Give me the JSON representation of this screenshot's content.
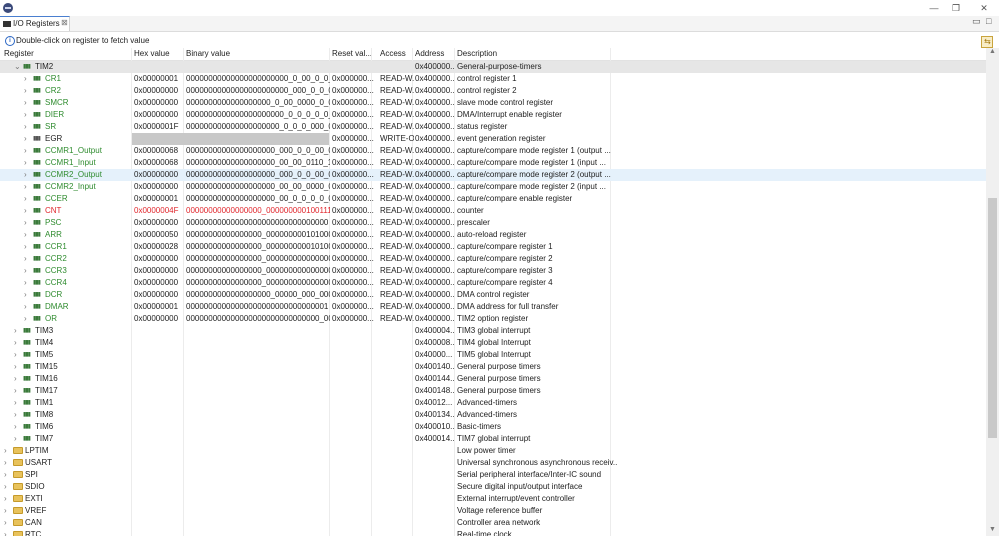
{
  "window": {
    "tab_label": "I/O Registers",
    "tab_close": "⊠",
    "minimize": "—",
    "restore": "❐",
    "close": "✕",
    "view_min": "▭",
    "view_max": "□"
  },
  "info": {
    "text": "Double-click on register to fetch value"
  },
  "refresh_icon": "⇆",
  "columns": [
    "Register",
    "Hex value",
    "Binary value",
    "Reset val...",
    "Access",
    "Address",
    "Description"
  ],
  "rows": [
    {
      "name": "TIM2",
      "hex": "",
      "bin": "",
      "reset": "",
      "access": "",
      "addr": "0x400000...",
      "desc": "General-purpose-timers",
      "level": 1,
      "exp": "v",
      "icon": "reg",
      "color": "",
      "style": "sel"
    },
    {
      "name": "CR1",
      "hex": "0x00000001",
      "bin": "00000000000000000000000_0_00_0_0_...",
      "reset": "0x000000...",
      "access": "READ-W...",
      "addr": "0x400000...",
      "desc": "control register 1",
      "level": 2,
      "exp": ">",
      "icon": "reg",
      "color": "green",
      "style": ""
    },
    {
      "name": "CR2",
      "hex": "0x00000000",
      "bin": "00000000000000000000000_000_0_0_0...",
      "reset": "0x000000...",
      "access": "READ-W...",
      "addr": "0x400000...",
      "desc": "control register 2",
      "level": 2,
      "exp": ">",
      "icon": "reg",
      "color": "green",
      "style": ""
    },
    {
      "name": "SMCR",
      "hex": "0x00000000",
      "bin": "0000000000000000000_0_00_0000_0_000_...",
      "reset": "0x000000...",
      "access": "READ-W...",
      "addr": "0x400000...",
      "desc": "slave mode control register",
      "level": 2,
      "exp": ">",
      "icon": "reg",
      "color": "green",
      "style": ""
    },
    {
      "name": "DIER",
      "hex": "0x00000000",
      "bin": "0000000000000000000000_0_0_0_0_0_0_...",
      "reset": "0x000000...",
      "access": "READ-W...",
      "addr": "0x400000...",
      "desc": "DMA/Interrupt enable register",
      "level": 2,
      "exp": ">",
      "icon": "reg",
      "color": "green",
      "style": ""
    },
    {
      "name": "SR",
      "hex": "0x0000001F",
      "bin": "000000000000000000000_0_0_0_000_01_...",
      "reset": "0x000000...",
      "access": "READ-W...",
      "addr": "0x400000...",
      "desc": "status register",
      "level": 2,
      "exp": ">",
      "icon": "reg",
      "color": "green",
      "style": ""
    },
    {
      "name": "EGR",
      "hex": "",
      "bin": "",
      "reset": "0x000000...",
      "access": "WRITE-O...",
      "addr": "0x400000...",
      "desc": "event generation register",
      "level": 2,
      "exp": ">",
      "icon": "gray",
      "color": "",
      "style": "",
      "gray": true
    },
    {
      "name": "CCMR1_Output",
      "hex": "0x00000068",
      "bin": "00000000000000000000_000_0_0_00_0_110...",
      "reset": "0x000000...",
      "access": "READ-W...",
      "addr": "0x400000...",
      "desc": "capture/compare mode register 1 (output ...",
      "level": 2,
      "exp": ">",
      "icon": "reg",
      "color": "green",
      "style": ""
    },
    {
      "name": "CCMR1_Input",
      "hex": "0x00000068",
      "bin": "00000000000000000000_00_00_0110_1...",
      "reset": "0x000000...",
      "access": "READ-W...",
      "addr": "0x400000...",
      "desc": "capture/compare mode register 1 (input ...",
      "level": 2,
      "exp": ">",
      "icon": "reg",
      "color": "green",
      "style": ""
    },
    {
      "name": "CCMR2_Output",
      "hex": "0x00000000",
      "bin": "00000000000000000000_000_0_0_00_0_000...",
      "reset": "0x000000...",
      "access": "READ-W...",
      "addr": "0x400000...",
      "desc": "capture/compare mode register 2 (output ...",
      "level": 2,
      "exp": ">",
      "icon": "reg",
      "color": "green",
      "style": "hl"
    },
    {
      "name": "CCMR2_Input",
      "hex": "0x00000000",
      "bin": "00000000000000000000_00_00_0000_0...",
      "reset": "0x000000...",
      "access": "READ-W...",
      "addr": "0x400000...",
      "desc": "capture/compare mode register 2 (input ...",
      "level": 2,
      "exp": ">",
      "icon": "reg",
      "color": "green",
      "style": ""
    },
    {
      "name": "CCER",
      "hex": "0x00000001",
      "bin": "00000000000000000000_00_0_0_0_0_0_0_...",
      "reset": "0x000000...",
      "access": "READ-W...",
      "addr": "0x400000...",
      "desc": "capture/compare enable register",
      "level": 2,
      "exp": ">",
      "icon": "reg",
      "color": "green",
      "style": ""
    },
    {
      "name": "CNT",
      "hex": "0x0000004F",
      "bin": "00000000000000000_0000000001001111",
      "reset": "0x000000...",
      "access": "READ-W...",
      "addr": "0x400000...",
      "desc": "counter",
      "level": 2,
      "exp": ">",
      "icon": "reg",
      "color": "red",
      "style": ""
    },
    {
      "name": "PSC",
      "hex": "0x00000000",
      "bin": "00000000000000000000000000000000",
      "reset": "0x000000...",
      "access": "READ-W...",
      "addr": "0x400000...",
      "desc": "prescaler",
      "level": 2,
      "exp": ">",
      "icon": "reg",
      "color": "green",
      "style": ""
    },
    {
      "name": "ARR",
      "hex": "0x00000050",
      "bin": "00000000000000000_0000000001010000",
      "reset": "0x000000...",
      "access": "READ-W...",
      "addr": "0x400000...",
      "desc": "auto-reload register",
      "level": 2,
      "exp": ">",
      "icon": "reg",
      "color": "green",
      "style": ""
    },
    {
      "name": "CCR1",
      "hex": "0x00000028",
      "bin": "00000000000000000_0000000000101000",
      "reset": "0x000000...",
      "access": "READ-W...",
      "addr": "0x400000...",
      "desc": "capture/compare register 1",
      "level": 2,
      "exp": ">",
      "icon": "reg",
      "color": "green",
      "style": ""
    },
    {
      "name": "CCR2",
      "hex": "0x00000000",
      "bin": "00000000000000000_0000000000000000",
      "reset": "0x000000...",
      "access": "READ-W...",
      "addr": "0x400000...",
      "desc": "capture/compare register 2",
      "level": 2,
      "exp": ">",
      "icon": "reg",
      "color": "green",
      "style": ""
    },
    {
      "name": "CCR3",
      "hex": "0x00000000",
      "bin": "00000000000000000_0000000000000000",
      "reset": "0x000000...",
      "access": "READ-W...",
      "addr": "0x400000...",
      "desc": "capture/compare register 3",
      "level": 2,
      "exp": ">",
      "icon": "reg",
      "color": "green",
      "style": ""
    },
    {
      "name": "CCR4",
      "hex": "0x00000000",
      "bin": "00000000000000000_0000000000000000",
      "reset": "0x000000...",
      "access": "READ-W...",
      "addr": "0x400000...",
      "desc": "capture/compare register 4",
      "level": 2,
      "exp": ">",
      "icon": "reg",
      "color": "green",
      "style": ""
    },
    {
      "name": "DCR",
      "hex": "0x00000000",
      "bin": "0000000000000000000_00000_000_00000",
      "reset": "0x000000...",
      "access": "READ-W...",
      "addr": "0x400000...",
      "desc": "DMA control register",
      "level": 2,
      "exp": ">",
      "icon": "reg",
      "color": "green",
      "style": ""
    },
    {
      "name": "DMAR",
      "hex": "0x00000001",
      "bin": "00000000000000000000000000000001",
      "reset": "0x000000...",
      "access": "READ-W...",
      "addr": "0x400000...",
      "desc": "DMA address for full transfer",
      "level": 2,
      "exp": ">",
      "icon": "reg",
      "color": "green",
      "style": ""
    },
    {
      "name": "OR",
      "hex": "0x00000000",
      "bin": "000000000000000000000000000000_00",
      "reset": "0x000000...",
      "access": "READ-W...",
      "addr": "0x400000...",
      "desc": "TIM2 option register",
      "level": 2,
      "exp": ">",
      "icon": "reg",
      "color": "green",
      "style": ""
    },
    {
      "name": "TIM3",
      "hex": "",
      "bin": "",
      "reset": "",
      "access": "",
      "addr": "0x400004...",
      "desc": "TIM3 global interrupt",
      "level": 1,
      "exp": ">",
      "icon": "reg",
      "color": "",
      "style": ""
    },
    {
      "name": "TIM4",
      "hex": "",
      "bin": "",
      "reset": "",
      "access": "",
      "addr": "0x400008...",
      "desc": "TIM4 global Interrupt",
      "level": 1,
      "exp": ">",
      "icon": "reg",
      "color": "",
      "style": ""
    },
    {
      "name": "TIM5",
      "hex": "",
      "bin": "",
      "reset": "",
      "access": "",
      "addr": "0x40000...",
      "desc": "TIM5 global Interrupt",
      "level": 1,
      "exp": ">",
      "icon": "reg",
      "color": "",
      "style": ""
    },
    {
      "name": "TIM15",
      "hex": "",
      "bin": "",
      "reset": "",
      "access": "",
      "addr": "0x400140...",
      "desc": "General purpose timers",
      "level": 1,
      "exp": ">",
      "icon": "reg",
      "color": "",
      "style": ""
    },
    {
      "name": "TIM16",
      "hex": "",
      "bin": "",
      "reset": "",
      "access": "",
      "addr": "0x400144...",
      "desc": "General purpose timers",
      "level": 1,
      "exp": ">",
      "icon": "reg",
      "color": "",
      "style": ""
    },
    {
      "name": "TIM17",
      "hex": "",
      "bin": "",
      "reset": "",
      "access": "",
      "addr": "0x400148...",
      "desc": "General purpose timers",
      "level": 1,
      "exp": ">",
      "icon": "reg",
      "color": "",
      "style": ""
    },
    {
      "name": "TIM1",
      "hex": "",
      "bin": "",
      "reset": "",
      "access": "",
      "addr": "0x40012...",
      "desc": "Advanced-timers",
      "level": 1,
      "exp": ">",
      "icon": "reg",
      "color": "",
      "style": ""
    },
    {
      "name": "TIM8",
      "hex": "",
      "bin": "",
      "reset": "",
      "access": "",
      "addr": "0x400134...",
      "desc": "Advanced-timers",
      "level": 1,
      "exp": ">",
      "icon": "reg",
      "color": "",
      "style": ""
    },
    {
      "name": "TIM6",
      "hex": "",
      "bin": "",
      "reset": "",
      "access": "",
      "addr": "0x400010...",
      "desc": "Basic-timers",
      "level": 1,
      "exp": ">",
      "icon": "reg",
      "color": "",
      "style": ""
    },
    {
      "name": "TIM7",
      "hex": "",
      "bin": "",
      "reset": "",
      "access": "",
      "addr": "0x400014...",
      "desc": "TIM7 global interrupt",
      "level": 1,
      "exp": ">",
      "icon": "reg",
      "color": "",
      "style": ""
    },
    {
      "name": "LPTIM",
      "hex": "",
      "bin": "",
      "reset": "",
      "access": "",
      "addr": "",
      "desc": "Low power timer",
      "level": 0,
      "exp": ">",
      "icon": "folder",
      "color": "",
      "style": ""
    },
    {
      "name": "USART",
      "hex": "",
      "bin": "",
      "reset": "",
      "access": "",
      "addr": "",
      "desc": "Universal synchronous asynchronous receiv...",
      "level": 0,
      "exp": ">",
      "icon": "folder",
      "color": "",
      "style": ""
    },
    {
      "name": "SPI",
      "hex": "",
      "bin": "",
      "reset": "",
      "access": "",
      "addr": "",
      "desc": "Serial peripheral interface/Inter-IC sound",
      "level": 0,
      "exp": ">",
      "icon": "folder",
      "color": "",
      "style": ""
    },
    {
      "name": "SDIO",
      "hex": "",
      "bin": "",
      "reset": "",
      "access": "",
      "addr": "",
      "desc": "Secure digital input/output interface",
      "level": 0,
      "exp": ">",
      "icon": "folder",
      "color": "",
      "style": ""
    },
    {
      "name": "EXTI",
      "hex": "",
      "bin": "",
      "reset": "",
      "access": "",
      "addr": "",
      "desc": "External interrupt/event controller",
      "level": 0,
      "exp": ">",
      "icon": "folder",
      "color": "",
      "style": ""
    },
    {
      "name": "VREF",
      "hex": "",
      "bin": "",
      "reset": "",
      "access": "",
      "addr": "",
      "desc": "Voltage reference buffer",
      "level": 0,
      "exp": ">",
      "icon": "folder",
      "color": "",
      "style": ""
    },
    {
      "name": "CAN",
      "hex": "",
      "bin": "",
      "reset": "",
      "access": "",
      "addr": "",
      "desc": "Controller area network",
      "level": 0,
      "exp": ">",
      "icon": "folder",
      "color": "",
      "style": ""
    },
    {
      "name": "RTC",
      "hex": "",
      "bin": "",
      "reset": "",
      "access": "",
      "addr": "",
      "desc": "Real-time clock",
      "level": 0,
      "exp": ">",
      "icon": "folder",
      "color": "",
      "style": ""
    }
  ]
}
